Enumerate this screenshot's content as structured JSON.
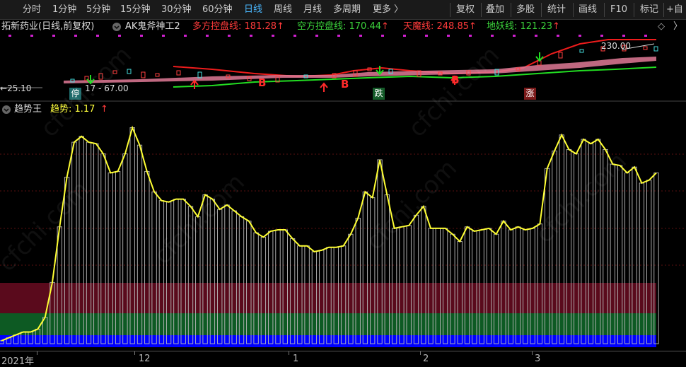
{
  "toolbar": {
    "periods": [
      "分时",
      "1分钟",
      "5分钟",
      "15分钟",
      "30分钟",
      "60分钟",
      "日线",
      "周线",
      "月线",
      "多周期",
      "更多 〉"
    ],
    "active_period": "日线",
    "right_buttons": [
      "复权",
      "叠加",
      "多股",
      "统计",
      "画线",
      "F10",
      "标记",
      "+自"
    ]
  },
  "infobar": {
    "stock_title": "拓新药业(日线,前复权)",
    "indicator_name": "AK鬼斧神工2",
    "lines": [
      {
        "label": "多方控盘线: 181.28",
        "arrow": "↑",
        "color": "#ff3b3b"
      },
      {
        "label": "空方控盘线: 170.44",
        "arrow": "↑",
        "color": "#3bd33b"
      },
      {
        "label": "天魔线: 248.85",
        "arrow": "↑",
        "color": "#ff3b3b"
      },
      {
        "label": "地妖线: 121.23",
        "arrow": "↑",
        "color": "#3bd33b"
      }
    ],
    "diamond": "◇"
  },
  "price_pane": {
    "high_label": "230.00",
    "low_label": "25.10",
    "mid_label": "17 - 67.00",
    "signals": {
      "buy": "B",
      "stop": "停",
      "fall": "跌",
      "rise": "涨"
    }
  },
  "indicator_pane": {
    "name": "趋势王",
    "value_label": "趋势: 1.17",
    "arrow": "↑"
  },
  "chart_data": {
    "type": "bar",
    "series": [
      {
        "name": "趋势",
        "values": [
          0.02,
          0.04,
          0.06,
          0.08,
          0.08,
          0.1,
          0.18,
          0.42,
          0.8,
          1.14,
          1.38,
          1.42,
          1.38,
          1.37,
          1.3,
          1.17,
          1.18,
          1.3,
          1.48,
          1.36,
          1.18,
          1.04,
          0.98,
          0.97,
          0.99,
          0.99,
          0.94,
          0.87,
          1.02,
          0.99,
          0.92,
          0.95,
          0.91,
          0.87,
          0.84,
          0.76,
          0.73,
          0.77,
          0.78,
          0.78,
          0.72,
          0.67,
          0.67,
          0.63,
          0.64,
          0.66,
          0.66,
          0.67,
          0.75,
          0.86,
          1.04,
          1.0,
          1.26,
          1.02,
          0.79,
          0.8,
          0.81,
          0.88,
          0.94,
          0.79,
          0.79,
          0.79,
          0.75,
          0.7,
          0.8,
          0.77,
          0.78,
          0.79,
          0.75,
          0.84,
          0.78,
          0.8,
          0.78,
          0.79,
          0.82,
          1.2,
          1.32,
          1.43,
          1.33,
          1.3,
          1.4,
          1.37,
          1.4,
          1.33,
          1.23,
          1.22,
          1.17,
          1.21,
          1.1,
          1.12,
          1.17
        ]
      }
    ],
    "ylim": [
      0,
      1.55
    ],
    "bands": [
      "#5a0a1c",
      "#0d5a23",
      "#0000ff"
    ]
  },
  "time_axis": {
    "labels": [
      "2021年",
      "12",
      "1",
      "2",
      "3"
    ]
  },
  "watermark": "cfchi.com"
}
